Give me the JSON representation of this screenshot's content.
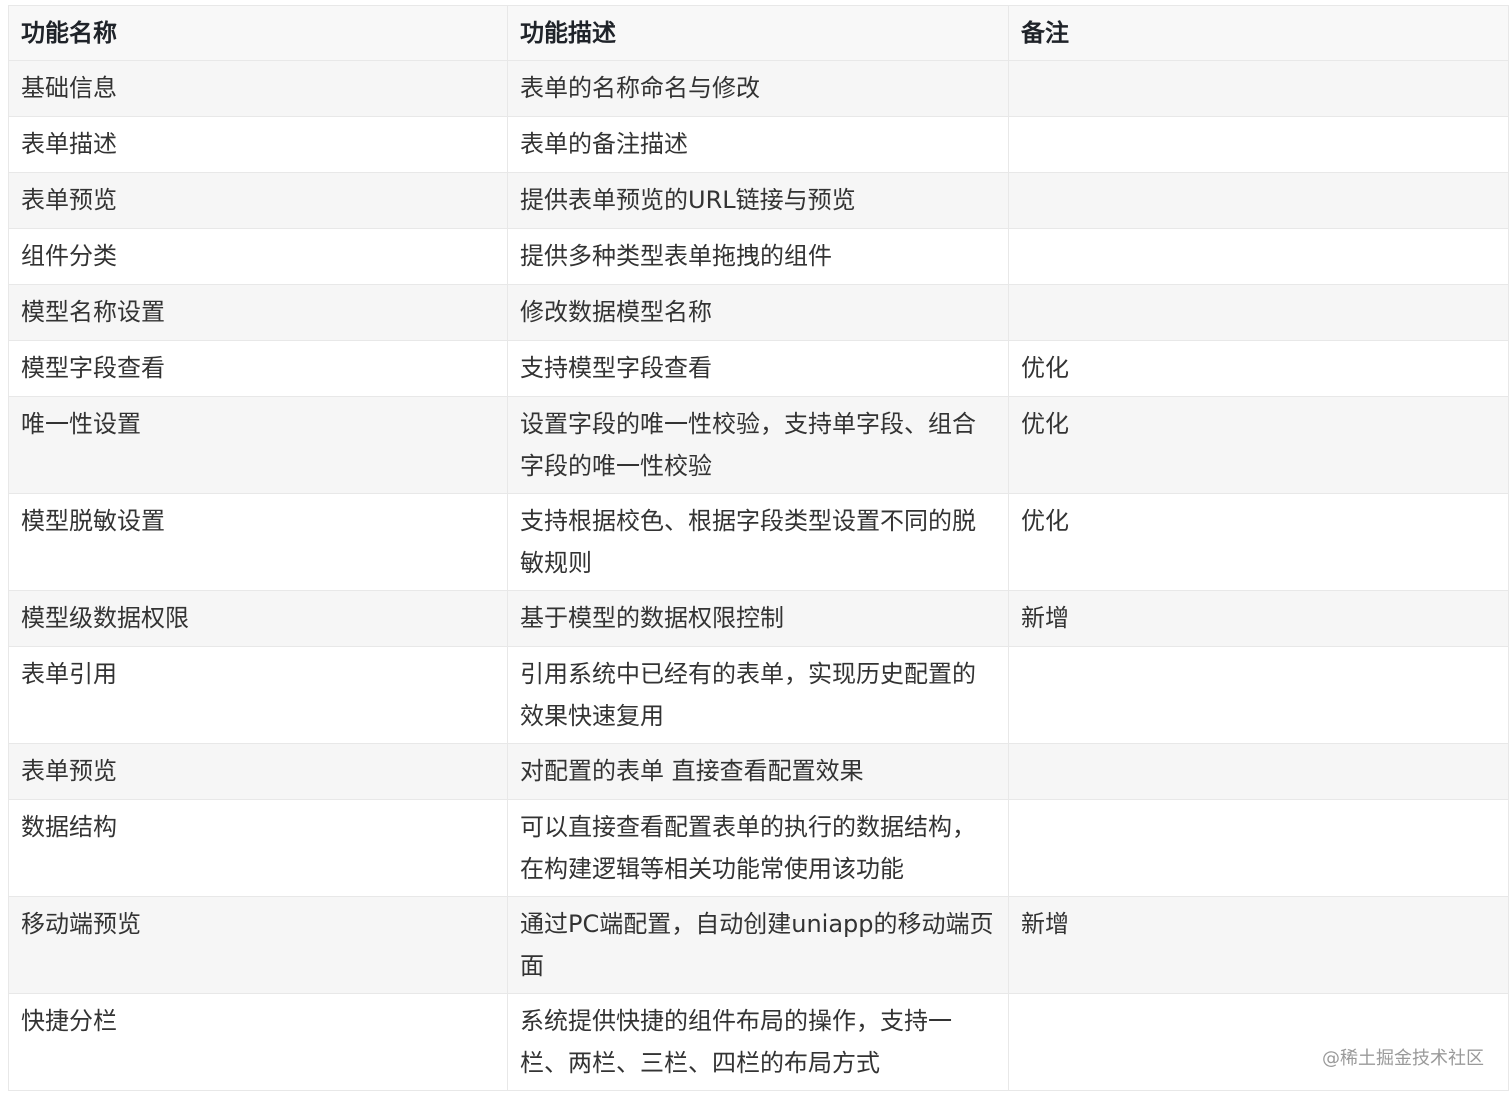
{
  "headers": [
    "功能名称",
    "功能描述",
    "备注"
  ],
  "rows": [
    {
      "name": "基础信息",
      "desc": "表单的名称命名与修改",
      "note": ""
    },
    {
      "name": "表单描述",
      "desc": "表单的备注描述",
      "note": ""
    },
    {
      "name": "表单预览",
      "desc": "提供表单预览的URL链接与预览",
      "note": ""
    },
    {
      "name": "组件分类",
      "desc": "提供多种类型表单拖拽的组件",
      "note": ""
    },
    {
      "name": "模型名称设置",
      "desc": "修改数据模型名称",
      "note": ""
    },
    {
      "name": "模型字段查看",
      "desc": "支持模型字段查看",
      "note": "优化"
    },
    {
      "name": "唯一性设置",
      "desc": "设置字段的唯一性校验，支持单字段、组合字段的唯一性校验",
      "note": "优化"
    },
    {
      "name": "模型脱敏设置",
      "desc": "支持根据校色、根据字段类型设置不同的脱敏规则",
      "note": "优化"
    },
    {
      "name": "模型级数据权限",
      "desc": "基于模型的数据权限控制",
      "note": "新增"
    },
    {
      "name": "表单引用",
      "desc": "引用系统中已经有的表单，实现历史配置的效果快速复用",
      "note": ""
    },
    {
      "name": "表单预览",
      "desc": "对配置的表单 直接查看配置效果",
      "note": ""
    },
    {
      "name": "数据结构",
      "desc": "可以直接查看配置表单的执行的数据结构，在构建逻辑等相关功能常使用该功能",
      "note": ""
    },
    {
      "name": "移动端预览",
      "desc": "通过PC端配置，自动创建uniapp的移动端页面",
      "note": "新增"
    },
    {
      "name": "快捷分栏",
      "desc": "系统提供快捷的组件布局的操作，支持一栏、两栏、三栏、四栏的布局方式",
      "note": ""
    }
  ],
  "watermark": "@稀土掘金技术社区"
}
